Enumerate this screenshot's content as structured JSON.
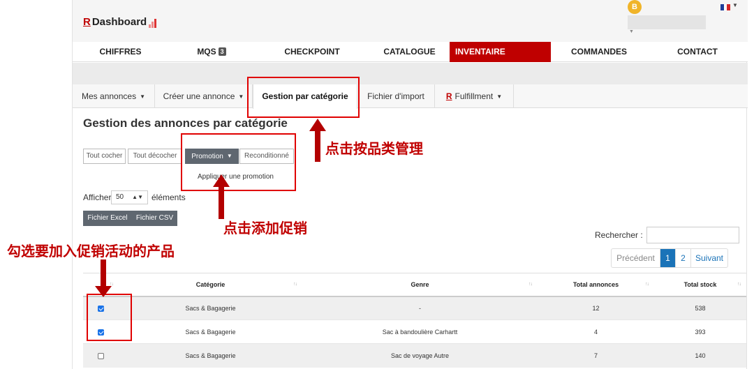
{
  "header": {
    "logo_r": "R",
    "logo_text": "Dashboard",
    "user_initial": "B"
  },
  "nav": {
    "items": [
      "CHIFFRES",
      "MQS",
      "CHECKPOINT",
      "CATALOGUE",
      "INVENTAIRE",
      "COMMANDES",
      "CONTACT"
    ],
    "mqs_badge": "3",
    "active": "INVENTAIRE"
  },
  "tabs": {
    "items": [
      "Mes annonces",
      "Créer une annonce",
      "Gestion par catégorie",
      "Fichier d'import",
      "Fulfillment"
    ],
    "fulfillment_r": "R",
    "active": "Gestion par catégorie"
  },
  "page": {
    "title": "Gestion des annonces par catégorie"
  },
  "toolbar": {
    "check_all": "Tout cocher",
    "uncheck_all": "Tout décocher",
    "promotion": "Promotion",
    "reconditionne": "Reconditionné",
    "apply_promotion": "Appliquer une promotion"
  },
  "length": {
    "prefix": "Afficher",
    "value": "50",
    "suffix": "éléments"
  },
  "export": {
    "excel": "Fichier Excel",
    "csv": "Fichier CSV"
  },
  "search": {
    "label": "Rechercher :",
    "value": ""
  },
  "pagination": {
    "prev": "Précédent",
    "current": "1",
    "page2": "2",
    "next": "Suivant"
  },
  "table": {
    "headers": [
      "",
      "Catégorie",
      "Genre",
      "Total annonces",
      "Total stock"
    ],
    "rows": [
      {
        "checked": true,
        "categorie": "Sacs & Bagagerie",
        "genre": "-",
        "total_annonces": "12",
        "total_stock": "538"
      },
      {
        "checked": true,
        "categorie": "Sacs & Bagagerie",
        "genre": "Sac à bandoulière Carhartt",
        "total_annonces": "4",
        "total_stock": "393"
      },
      {
        "checked": false,
        "categorie": "Sacs & Bagagerie",
        "genre": "Sac de voyage Autre",
        "total_annonces": "7",
        "total_stock": "140"
      }
    ]
  },
  "annotations": {
    "by_category": "点击按品类管理",
    "add_promotion": "点击添加促销",
    "select_products": "勾选要加入促销活动的产品"
  },
  "colors": {
    "brand_red": "#bf0000",
    "annotation_red": "#e00000",
    "primary_blue": "#1a73b8"
  }
}
